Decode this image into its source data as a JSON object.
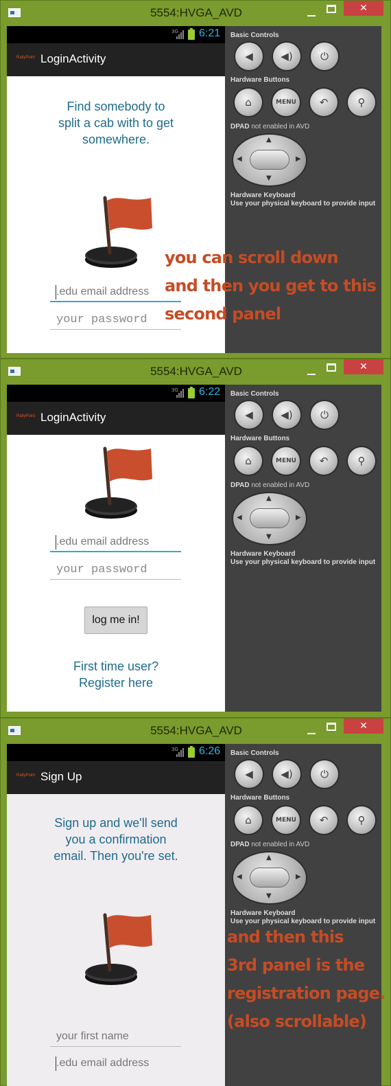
{
  "colors": {
    "window_frame": "#7a9b2d",
    "close_button": "#c84242",
    "accent_text": "#1f6b8c",
    "clock": "#33b5e5",
    "annotation": "#c64c25",
    "flag": "#c84e2e"
  },
  "panels": [
    {
      "window_title": "5554:HVGA_AVD",
      "network": "3G",
      "time": "6:21",
      "app_logo": "RallyPoint",
      "activity_title": "LoginActivity",
      "tagline": [
        "Find somebody to",
        "split a cab with to get",
        "somewhere."
      ],
      "email_placeholder": ".edu email address",
      "password_placeholder": "your password"
    },
    {
      "window_title": "5554:HVGA_AVD",
      "network": "3G",
      "time": "6:22",
      "app_logo": "RallyPoint",
      "activity_title": "LoginActivity",
      "email_placeholder": ".edu email address",
      "password_placeholder": "your password",
      "login_button": "log me in!",
      "register_link": [
        "First time user?",
        "Register here"
      ]
    },
    {
      "window_title": "5554:HVGA_AVD",
      "network": "3G",
      "time": "6:26",
      "app_logo": "RallyPoint",
      "activity_title": "Sign Up",
      "tagline": [
        "Sign up and we'll send",
        "you a confirmation",
        "email. Then you're set."
      ],
      "first_name_placeholder": "your first name",
      "email_placeholder": ".edu email address"
    }
  ],
  "emulator_controls": {
    "basic_controls": "Basic Controls",
    "hardware_buttons": "Hardware Buttons",
    "menu_label": "MENU",
    "dpad_label": "DPAD",
    "dpad_status": "not enabled in AVD",
    "hardware_keyboard": "Hardware Keyboard",
    "keyboard_hint": "Use your physical keyboard to provide input",
    "icons": [
      "volume-down-icon",
      "volume-up-icon",
      "power-icon",
      "home-icon",
      "menu-icon",
      "back-icon",
      "search-icon"
    ]
  },
  "annotations": {
    "first": [
      "you can scroll down",
      "and then you get to this",
      "second panel"
    ],
    "second": [
      "and then this",
      "3rd panel is the",
      "registration page.",
      "(also scrollable)"
    ]
  }
}
